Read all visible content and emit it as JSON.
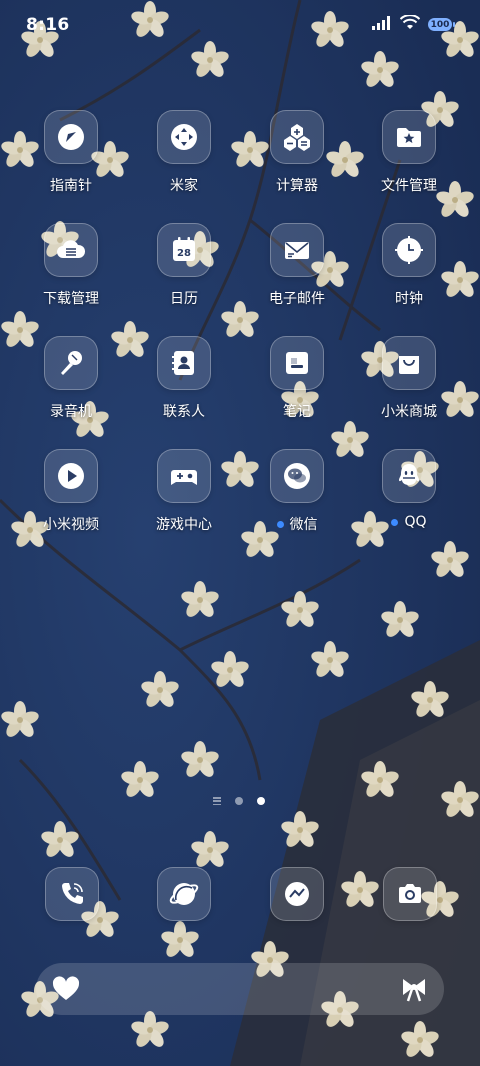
{
  "status_bar": {
    "time": "8:16",
    "battery_level": "100",
    "icons": [
      "signal-icon",
      "wifi-icon",
      "battery-icon"
    ]
  },
  "apps": [
    {
      "label": "指南针",
      "icon": "compass-icon"
    },
    {
      "label": "米家",
      "icon": "mijia-icon"
    },
    {
      "label": "计算器",
      "icon": "calculator-icon"
    },
    {
      "label": "文件管理",
      "icon": "folder-star-icon"
    },
    {
      "label": "下载管理",
      "icon": "download-cloud-icon"
    },
    {
      "label": "日历",
      "icon": "calendar-icon",
      "day": "28"
    },
    {
      "label": "电子邮件",
      "icon": "mail-icon"
    },
    {
      "label": "时钟",
      "icon": "clock-icon"
    },
    {
      "label": "录音机",
      "icon": "microphone-icon"
    },
    {
      "label": "联系人",
      "icon": "contacts-icon"
    },
    {
      "label": "笔记",
      "icon": "notes-icon"
    },
    {
      "label": "小米商城",
      "icon": "shopping-bag-icon"
    },
    {
      "label": "小米视频",
      "icon": "play-icon"
    },
    {
      "label": "游戏中心",
      "icon": "gamepad-icon"
    },
    {
      "label": "微信",
      "icon": "wechat-icon",
      "notification": true
    },
    {
      "label": "QQ",
      "icon": "qq-icon",
      "notification": true
    }
  ],
  "page_indicator": {
    "pages": 2,
    "active_page": 2
  },
  "dock": [
    {
      "icon": "phone-icon"
    },
    {
      "icon": "browser-icon"
    },
    {
      "icon": "messages-icon"
    },
    {
      "icon": "camera-icon"
    }
  ],
  "bottom_bar": {
    "left_icon": "heart-icon",
    "right_icon": "bow-icon"
  },
  "colors": {
    "sky": "#1f3562",
    "blossom": "#efe7cf",
    "notification_dot": "#3d8bff"
  }
}
